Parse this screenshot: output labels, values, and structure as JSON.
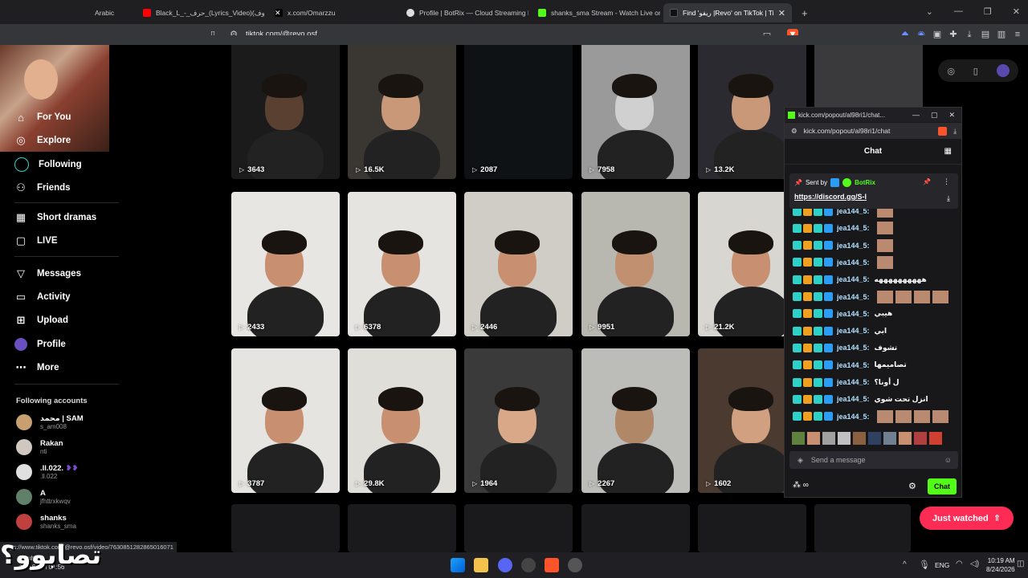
{
  "browser": {
    "tabs": [
      {
        "title": "Arabic",
        "color": "#888888"
      },
      {
        "title": "Black_L_-_حرف_(Lyrics_Video)(محذوف) -",
        "color": "#ff0000"
      },
      {
        "title": "x.com/Omarzzu",
        "color": "#ffffff"
      },
      {
        "title": "Profile | BotRix — Cloud Streaming B",
        "color": "#dddddd"
      },
      {
        "title": "shanks_sma Stream - Watch Live on",
        "color": "#53fc18"
      },
      {
        "title": "Find 'ريفو |Revo' on TikTok | TikTo",
        "color": "#ffffff"
      }
    ],
    "url": "tiktok.com/@revo.osf",
    "status_url": "https://www.tiktok.com/@revo.osf/video/7630851282865016071"
  },
  "sidebar": {
    "nav": [
      {
        "label": "For You",
        "icon": "home-icon"
      },
      {
        "label": "Explore",
        "icon": "compass-icon"
      },
      {
        "label": "Following",
        "icon": "following-icon"
      },
      {
        "label": "Friends",
        "icon": "friends-icon"
      },
      {
        "label": "Short dramas",
        "icon": "film-icon"
      },
      {
        "label": "LIVE",
        "icon": "live-icon"
      },
      {
        "label": "Messages",
        "icon": "send-icon"
      },
      {
        "label": "Activity",
        "icon": "activity-icon"
      },
      {
        "label": "Upload",
        "icon": "upload-icon"
      },
      {
        "label": "Profile",
        "icon": "profile-icon"
      },
      {
        "label": "More",
        "icon": "more-icon"
      }
    ],
    "following_title": "Following accounts",
    "accounts": [
      {
        "name": "محمد | SAM",
        "handle": "s_am008",
        "color": "#c8a070"
      },
      {
        "name": "Rakan",
        "handle": "nti",
        "color": "#d0c8c0"
      },
      {
        "name": ".ll.022.",
        "handle": ".ll.022",
        "color": "#e0e0e0"
      },
      {
        "name": "A",
        "handle": "jfhttrxkwqv",
        "color": "#60806a"
      },
      {
        "name": "shanks",
        "handle": "shanks_sma",
        "color": "#c04040"
      }
    ]
  },
  "videos": [
    {
      "views": "3643",
      "bg": "#1b1b1b",
      "skin": "#5a4030"
    },
    {
      "views": "16.5K",
      "bg": "#3a3632",
      "skin": "#c89878"
    },
    {
      "views": "2087",
      "bg": "#0e1214",
      "skin": "#0e1214"
    },
    {
      "views": "7958",
      "bg": "#9a9a9a",
      "skin": "#d0d0d0"
    },
    {
      "views": "13.2K",
      "bg": "#2b2a30",
      "skin": "#c89878"
    },
    {
      "views": "2433",
      "bg": "#e8e6e2",
      "skin": "#c89070"
    },
    {
      "views": "6378",
      "bg": "#e6e4e0",
      "skin": "#c89070"
    },
    {
      "views": "2446",
      "bg": "#d0ccc6",
      "skin": "#c89070"
    },
    {
      "views": "9951",
      "bg": "#b8b8b0",
      "skin": "#c09070"
    },
    {
      "views": "21.2K",
      "bg": "#d8d6d0",
      "skin": "#c89070"
    },
    {
      "views": "3787",
      "bg": "#e6e4e0",
      "skin": "#c89070"
    },
    {
      "views": "29.8K",
      "bg": "#e0ded8",
      "skin": "#c89070"
    },
    {
      "views": "1964",
      "bg": "#3a3a3a",
      "skin": "#d8a888"
    },
    {
      "views": "2267",
      "bg": "#bcbcb8",
      "skin": "#b08868"
    },
    {
      "views": "1602",
      "bg": "#4a3a30",
      "skin": "#d0a080"
    }
  ],
  "chat": {
    "popup_title": "kick.com/popout/al98ri1/chat...",
    "popup_url": "kick.com/popout/al98ri1/chat",
    "header": "Chat",
    "pinned_sent_by": "Sent by",
    "pinned_user": "BotRix",
    "pinned_link": "https://discord.gg/S-l",
    "messages": [
      {
        "user": "jea144_5:",
        "text": "",
        "emotes": 1
      },
      {
        "user": "jea144_5:",
        "text": "",
        "emotes": 1
      },
      {
        "user": "jea144_5:",
        "text": "",
        "emotes": 1
      },
      {
        "user": "jea144_5:",
        "text": "",
        "emotes": 1
      },
      {
        "user": "jea144_5:",
        "text": "ههههههههههه",
        "emotes": 0
      },
      {
        "user": "jea144_5:",
        "text": "",
        "emotes": 4
      },
      {
        "user": "jea144_5:",
        "text": "هيبي",
        "emotes": 0
      },
      {
        "user": "jea144_5:",
        "text": "ابي",
        "emotes": 0
      },
      {
        "user": "jea144_5:",
        "text": "تشوف",
        "emotes": 0
      },
      {
        "user": "jea144_5:",
        "text": "تصاميمها",
        "emotes": 0
      },
      {
        "user": "jea144_5:",
        "text": "ل أونا؟",
        "emotes": 0
      },
      {
        "user": "jea144_5:",
        "text": "انزل تحت شوي",
        "emotes": 0
      },
      {
        "user": "jea144_5:",
        "text": "",
        "emotes": 4
      }
    ],
    "input_placeholder": "Send a message",
    "send_label": "Chat"
  },
  "just_watched": "Just watched",
  "overlay_logo": "تصابوو؟",
  "taskbar": {
    "lang": "ENG",
    "time": "10:19 AM",
    "date": "8/24/2026",
    "weather_label": "Dhuhr",
    "weather_time": "12:16 PM",
    "weather_sub": "01:56"
  },
  "colors": {
    "tiktok_pink": "#fe2c55",
    "kick_green": "#53fc18"
  }
}
